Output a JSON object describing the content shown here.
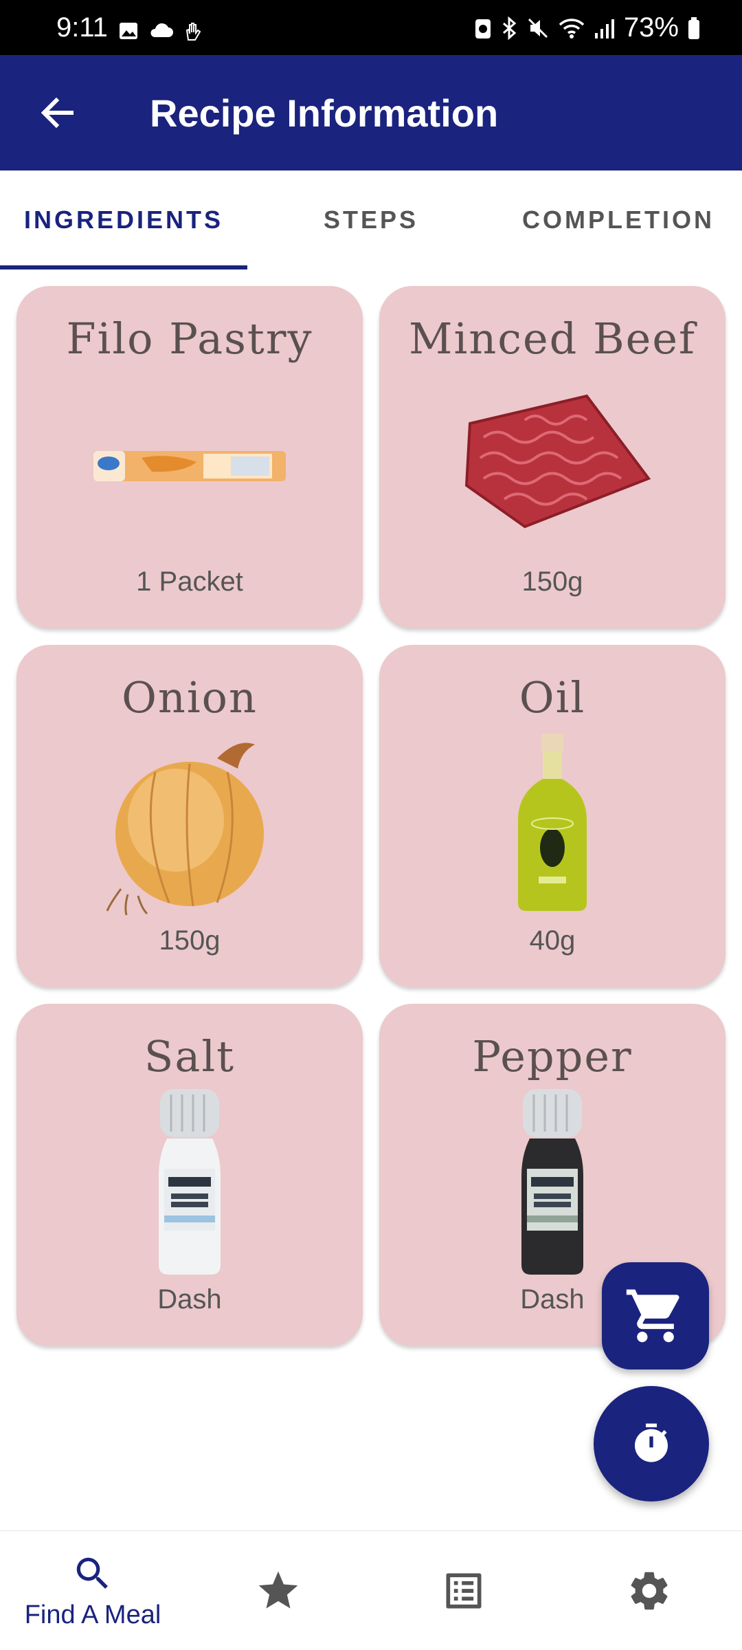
{
  "status_bar": {
    "time": "9:11",
    "battery": "73%"
  },
  "app_bar": {
    "title": "Recipe Information"
  },
  "tabs": [
    {
      "label": "INGREDIENTS",
      "active": true
    },
    {
      "label": "STEPS",
      "active": false
    },
    {
      "label": "COMPLETION",
      "active": false
    }
  ],
  "ingredients": [
    {
      "name": "Filo Pastry",
      "quantity": "1 Packet",
      "icon": "filo-pastry-image"
    },
    {
      "name": "Minced Beef",
      "quantity": "150g",
      "icon": "minced-beef-image"
    },
    {
      "name": "Onion",
      "quantity": "150g",
      "icon": "onion-image"
    },
    {
      "name": "Oil",
      "quantity": "40g",
      "icon": "olive-oil-image"
    },
    {
      "name": "Salt",
      "quantity": "Dash",
      "icon": "salt-grinder-image"
    },
    {
      "name": "Pepper",
      "quantity": "Dash",
      "icon": "pepper-grinder-image"
    }
  ],
  "fabs": {
    "cart_icon": "cart-icon",
    "timer_icon": "timer-icon"
  },
  "bottom_nav": [
    {
      "label": "Find A Meal",
      "icon": "search-icon",
      "active": true
    },
    {
      "label": "",
      "icon": "star-icon",
      "active": false
    },
    {
      "label": "",
      "icon": "list-icon",
      "active": false
    },
    {
      "label": "",
      "icon": "gear-icon",
      "active": false
    }
  ],
  "colors": {
    "primary": "#1a237e",
    "card_bg": "#ecc9cc",
    "text_muted": "#555555"
  }
}
